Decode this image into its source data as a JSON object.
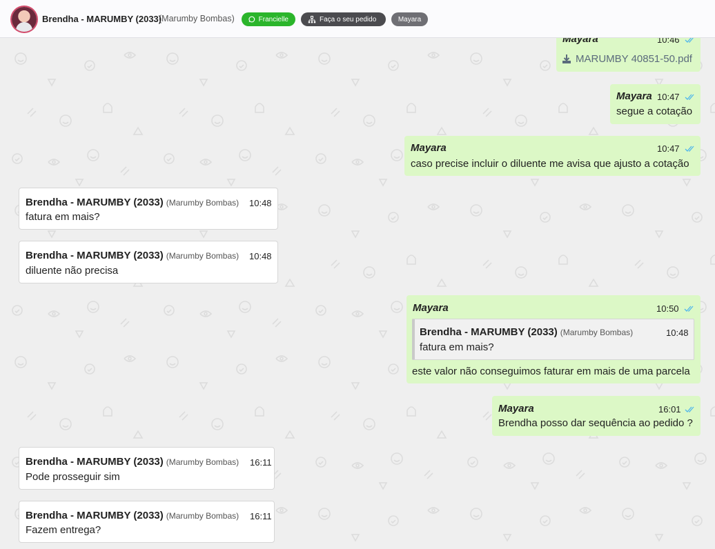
{
  "header": {
    "contact_name": "Brendha - MARUMBY (2033)",
    "contact_company": "(Marumby Bombas)",
    "tags": {
      "agent": "Francielle",
      "order": "Faça o seu pedido",
      "assignee": "Mayara"
    },
    "icons": [
      "avatar",
      "whatsapp-icon",
      "network-icon"
    ]
  },
  "colors": {
    "outgoing_bubble": "#dcf8c6",
    "incoming_bubble": "#ffffff",
    "read_ticks": "#4fb6ec",
    "tag_green": "#2bb52b"
  },
  "messages": {
    "m1": {
      "sender": "Mayara",
      "time": "10:46",
      "file": "MARUMBY 40851-50.pdf"
    },
    "m2": {
      "sender": "Mayara",
      "time": "10:47",
      "text": "segue a cotação"
    },
    "m3": {
      "sender": "Mayara",
      "time": "10:47",
      "text": "caso precise incluir o diluente me avisa que ajusto a cotação"
    },
    "m4": {
      "sender": "Brendha - MARUMBY (2033)",
      "company": "(Marumby Bombas)",
      "time": "10:48",
      "text": "fatura em mais?"
    },
    "m5": {
      "sender": "Brendha - MARUMBY (2033)",
      "company": "(Marumby Bombas)",
      "time": "10:48",
      "text": "diluente não precisa"
    },
    "m6": {
      "sender": "Mayara",
      "time": "10:50",
      "quote": {
        "sender": "Brendha - MARUMBY (2033)",
        "company": "(Marumby Bombas)",
        "time": "10:48",
        "text": "fatura em mais?"
      },
      "text": "este valor não conseguimos faturar em mais de uma parcela"
    },
    "m7": {
      "sender": "Mayara",
      "time": "16:01",
      "text": "Brendha posso dar sequência ao pedido ?"
    },
    "m8": {
      "sender": "Brendha - MARUMBY (2033)",
      "company": "(Marumby Bombas)",
      "time": "16:11",
      "text": "Pode prosseguir sim"
    },
    "m9": {
      "sender": "Brendha - MARUMBY (2033)",
      "company": "(Marumby Bombas)",
      "time": "16:11",
      "text": "Fazem entrega?"
    }
  }
}
